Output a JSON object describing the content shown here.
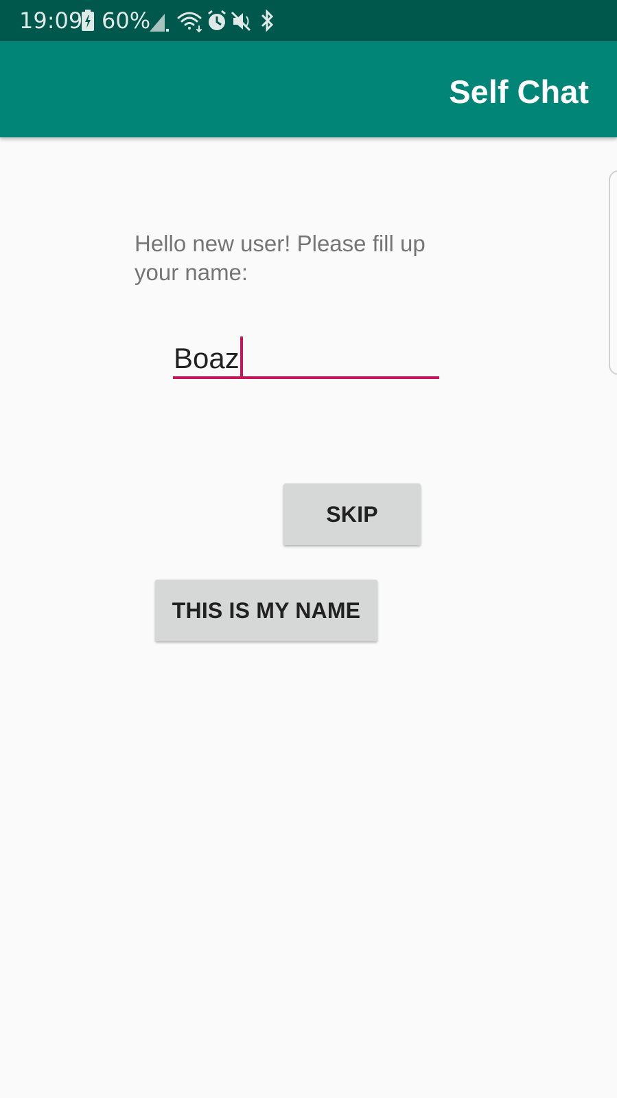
{
  "status_bar": {
    "time": "19:09",
    "battery_percent": "60%",
    "icons": [
      "battery-charging-icon",
      "signal-icon",
      "wifi-icon",
      "alarm-icon",
      "mute-icon",
      "bluetooth-icon"
    ]
  },
  "app_bar": {
    "title": "Self Chat",
    "color": "#008577"
  },
  "main": {
    "prompt": "Hello new user! Please fill up your name:",
    "name_input_value": "Boaz",
    "accent_color": "#c2185b"
  },
  "buttons": {
    "skip_label": "SKIP",
    "confirm_label": "THIS IS MY NAME"
  }
}
